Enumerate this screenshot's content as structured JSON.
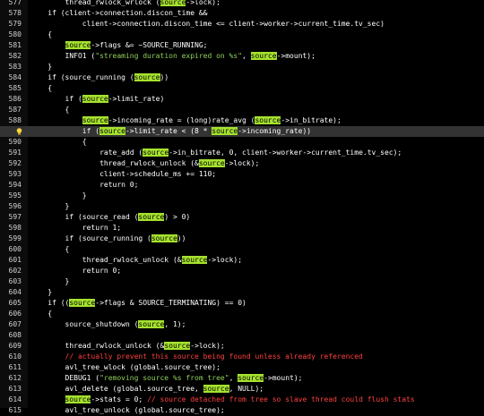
{
  "colors": {
    "background": "#000000",
    "default_text": "#ffffff",
    "string": "#8fd05a",
    "comment": "#ff4040",
    "highlight": "#a6e22e",
    "current_line": "#333333"
  },
  "lines": [
    {
      "n": "577",
      "t": [
        [
          "a",
          "        thread_rwlock_wrlock ("
        ],
        [
          "hl",
          "source"
        ],
        [
          "a",
          "->lock);"
        ]
      ]
    },
    {
      "n": "578",
      "t": [
        [
          "a",
          "    if (client->connection.discon_time &&"
        ]
      ]
    },
    {
      "n": "579",
      "t": [
        [
          "a",
          "            client->connection.discon_time <= client->worker->current_time.tv_sec)"
        ]
      ]
    },
    {
      "n": "580",
      "t": [
        [
          "a",
          "    {"
        ]
      ]
    },
    {
      "n": "581",
      "t": [
        [
          "a",
          "        "
        ],
        [
          "hl",
          "source"
        ],
        [
          "a",
          "->flags &= ~SOURCE_RUNNING;"
        ]
      ]
    },
    {
      "n": "582",
      "t": [
        [
          "a",
          "        INFO1 ("
        ],
        [
          "s",
          "\"streaming duration expired on %s\""
        ],
        [
          "a",
          ", "
        ],
        [
          "hl",
          "source"
        ],
        [
          "a",
          "->mount);"
        ]
      ]
    },
    {
      "n": "583",
      "t": [
        [
          "a",
          "    }"
        ]
      ]
    },
    {
      "n": "584",
      "t": [
        [
          "a",
          "    if (source_running ("
        ],
        [
          "hl",
          "source"
        ],
        [
          "a",
          "))"
        ]
      ]
    },
    {
      "n": "585",
      "t": [
        [
          "a",
          "    {"
        ]
      ]
    },
    {
      "n": "586",
      "t": [
        [
          "a",
          "        if ("
        ],
        [
          "hl",
          "source"
        ],
        [
          "a",
          "->limit_rate)"
        ]
      ]
    },
    {
      "n": "587",
      "t": [
        [
          "a",
          "        {"
        ]
      ]
    },
    {
      "n": "588",
      "t": [
        [
          "a",
          "            "
        ],
        [
          "hl",
          "source"
        ],
        [
          "a",
          "->incoming_rate = (long)rate_avg ("
        ],
        [
          "hl",
          "source"
        ],
        [
          "a",
          "->in_bitrate);"
        ]
      ]
    },
    {
      "n": "",
      "bulb": true,
      "current": true,
      "t": [
        [
          "a",
          "            if ("
        ],
        [
          "hl",
          "source"
        ],
        [
          "a",
          "->limit_rate < (8 * "
        ],
        [
          "hl",
          "source"
        ],
        [
          "a",
          "->incoming_rate))"
        ]
      ]
    },
    {
      "n": "590",
      "t": [
        [
          "a",
          "            {"
        ]
      ]
    },
    {
      "n": "591",
      "t": [
        [
          "a",
          "                rate_add ("
        ],
        [
          "hl",
          "source"
        ],
        [
          "a",
          "->in_bitrate, 0, client->worker->current_time.tv_sec);"
        ]
      ]
    },
    {
      "n": "592",
      "t": [
        [
          "a",
          "                thread_rwlock_unlock (&"
        ],
        [
          "hl",
          "source"
        ],
        [
          "a",
          "->lock);"
        ]
      ]
    },
    {
      "n": "593",
      "t": [
        [
          "a",
          "                client->schedule_ms += 110;"
        ]
      ]
    },
    {
      "n": "594",
      "t": [
        [
          "a",
          "                return 0;"
        ]
      ]
    },
    {
      "n": "595",
      "t": [
        [
          "a",
          "            }"
        ]
      ]
    },
    {
      "n": "596",
      "t": [
        [
          "a",
          "        }"
        ]
      ]
    },
    {
      "n": "597",
      "t": [
        [
          "a",
          "        if (source_read ("
        ],
        [
          "hl",
          "source"
        ],
        [
          "a",
          ") > 0)"
        ]
      ]
    },
    {
      "n": "598",
      "t": [
        [
          "a",
          "            return 1;"
        ]
      ]
    },
    {
      "n": "599",
      "t": [
        [
          "a",
          "        if (source_running ("
        ],
        [
          "hl",
          "source"
        ],
        [
          "a",
          "))"
        ]
      ]
    },
    {
      "n": "600",
      "t": [
        [
          "a",
          "        {"
        ]
      ]
    },
    {
      "n": "601",
      "t": [
        [
          "a",
          "            thread_rwlock_unlock (&"
        ],
        [
          "hl",
          "source"
        ],
        [
          "a",
          "->lock);"
        ]
      ]
    },
    {
      "n": "602",
      "t": [
        [
          "a",
          "            return 0;"
        ]
      ]
    },
    {
      "n": "603",
      "t": [
        [
          "a",
          "        }"
        ]
      ]
    },
    {
      "n": "604",
      "t": [
        [
          "a",
          "    }"
        ]
      ]
    },
    {
      "n": "605",
      "t": [
        [
          "a",
          "    if (("
        ],
        [
          "hl",
          "source"
        ],
        [
          "a",
          "->flags & SOURCE_TERMINATING) == 0)"
        ]
      ]
    },
    {
      "n": "606",
      "t": [
        [
          "a",
          "    {"
        ]
      ]
    },
    {
      "n": "607",
      "t": [
        [
          "a",
          "        source_shutdown ("
        ],
        [
          "hl",
          "source"
        ],
        [
          "a",
          ", 1);"
        ]
      ]
    },
    {
      "n": "608",
      "t": [
        [
          "a",
          ""
        ]
      ]
    },
    {
      "n": "609",
      "t": [
        [
          "a",
          "        thread_rwlock_unlock (&"
        ],
        [
          "hl",
          "source"
        ],
        [
          "a",
          "->lock);"
        ]
      ]
    },
    {
      "n": "610",
      "t": [
        [
          "a",
          "        "
        ],
        [
          "r",
          "// actually prevent this source being found unless already referenced"
        ]
      ]
    },
    {
      "n": "611",
      "t": [
        [
          "a",
          "        avl_tree_wlock (global.source_tree);"
        ]
      ]
    },
    {
      "n": "612",
      "t": [
        [
          "a",
          "        DEBUG1 ("
        ],
        [
          "s",
          "\"removing source %s from tree\""
        ],
        [
          "a",
          ", "
        ],
        [
          "hl",
          "source"
        ],
        [
          "a",
          "->mount);"
        ]
      ]
    },
    {
      "n": "613",
      "t": [
        [
          "a",
          "        avl_delete (global.source_tree, "
        ],
        [
          "hl",
          "source"
        ],
        [
          "a",
          ", NULL);"
        ]
      ]
    },
    {
      "n": "614",
      "t": [
        [
          "a",
          "        "
        ],
        [
          "hl",
          "source"
        ],
        [
          "a",
          "->stats = 0; "
        ],
        [
          "r",
          "// source detached from tree so slave thread could flush stats"
        ]
      ]
    },
    {
      "n": "615",
      "t": [
        [
          "a",
          "        avl_tree_unlock (global.source_tree);"
        ]
      ]
    }
  ]
}
